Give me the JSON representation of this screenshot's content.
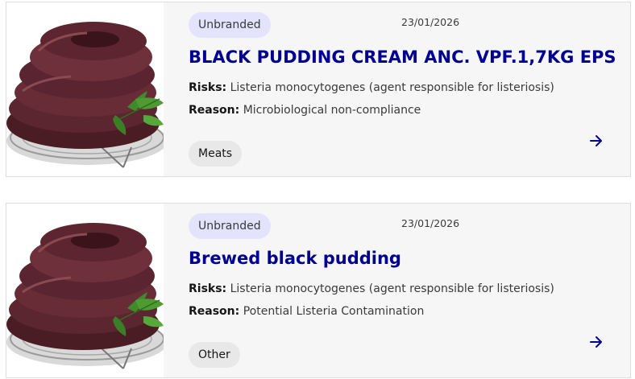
{
  "recalls": [
    {
      "brand": "Unbranded",
      "date": "23/01/2026",
      "title": "BLACK PUDDING CREAM ANC. VPF.1,7KG EPS",
      "risks_label": "Risks:",
      "risks": "Listeria monocytogenes (agent responsible for listeriosis)",
      "reason_label": "Reason:",
      "reason": "Microbiological non-compliance",
      "category": "Meats",
      "image_icon": "black-pudding-photo",
      "action_icon": "arrow-right-icon"
    },
    {
      "brand": "Unbranded",
      "date": "23/01/2026",
      "title": "Brewed black pudding",
      "risks_label": "Risks:",
      "risks": "Listeria monocytogenes (agent responsible for listeriosis)",
      "reason_label": "Reason:",
      "reason": "Potential Listeria Contamination",
      "category": "Other",
      "image_icon": "black-pudding-photo",
      "action_icon": "arrow-right-icon"
    }
  ],
  "colors": {
    "title": "#000091",
    "brand_tag_bg": "#e3e3fd",
    "category_tag_bg": "#e8e8e8",
    "card_bg": "#f6f6f6"
  }
}
